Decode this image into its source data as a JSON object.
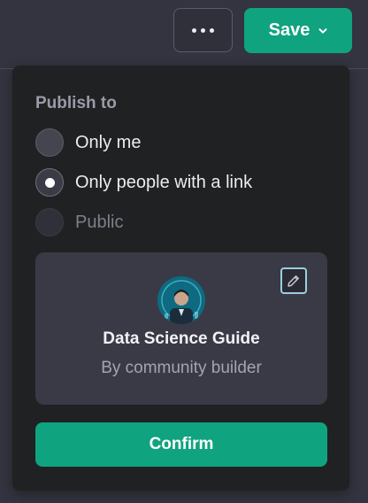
{
  "header": {
    "more_icon": "ellipsis-icon",
    "save_label": "Save",
    "save_icon": "chevron-down-icon",
    "accent_color": "#10a37f"
  },
  "publish": {
    "title": "Publish to",
    "options": [
      {
        "label": "Only me",
        "selected": false,
        "disabled": false
      },
      {
        "label": "Only people with a link",
        "selected": true,
        "disabled": false
      },
      {
        "label": "Public",
        "selected": false,
        "disabled": true
      }
    ]
  },
  "gpt": {
    "name": "Data Science Guide",
    "author": "By community builder",
    "edit_icon": "pencil-icon"
  },
  "confirm_label": "Confirm"
}
